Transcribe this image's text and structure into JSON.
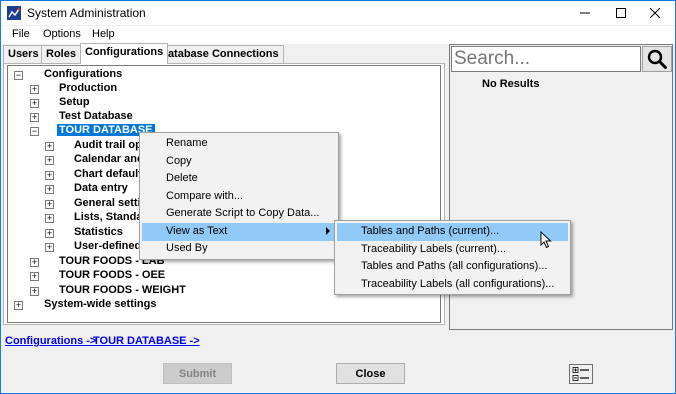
{
  "window": {
    "title": "System Administration"
  },
  "menubar": {
    "items": [
      "File",
      "Options",
      "Help"
    ]
  },
  "tabs": [
    "Users",
    "Roles",
    "Configurations",
    "Database Connections"
  ],
  "active_tab": "Configurations",
  "tree": {
    "rows": [
      {
        "label": "Configurations",
        "expander": "−"
      },
      {
        "label": "Production",
        "expander": "+"
      },
      {
        "label": "Setup",
        "expander": "+"
      },
      {
        "label": "Test Database",
        "expander": "+"
      },
      {
        "label": "TOUR DATABASE",
        "expander": "−",
        "selected": true
      },
      {
        "label": "Audit trail optio",
        "expander": "+"
      },
      {
        "label": "Calendar and c",
        "expander": "+"
      },
      {
        "label": "Chart defaults",
        "expander": "+"
      },
      {
        "label": "Data entry",
        "expander": "+"
      },
      {
        "label": "General setting",
        "expander": "+"
      },
      {
        "label": "Lists, Standard",
        "expander": "+"
      },
      {
        "label": "Statistics",
        "expander": "+"
      },
      {
        "label": "User-defined la",
        "expander": "+"
      },
      {
        "label": "TOUR FOODS - LAB",
        "expander": "+"
      },
      {
        "label": "TOUR FOODS - OEE",
        "expander": "+"
      },
      {
        "label": "TOUR FOODS - WEIGHT",
        "expander": "+"
      },
      {
        "label": "System-wide settings",
        "expander": "+"
      }
    ]
  },
  "search": {
    "placeholder": "Search...",
    "results_text": "No Results"
  },
  "breadcrumb": [
    "Configurations ->",
    "TOUR DATABASE ->"
  ],
  "buttons": {
    "submit": "Submit",
    "close": "Close"
  },
  "context_menu": {
    "items": [
      "Rename",
      "Copy",
      "Delete",
      "Compare with...",
      "Generate Script to Copy Data...",
      "View as Text",
      "Used By"
    ],
    "highlighted": "View as Text"
  },
  "submenu": {
    "items": [
      "Tables and Paths (current)...",
      "Traceability Labels (current)...",
      "Tables and Paths (all configurations)...",
      "Traceability Labels (all configurations)..."
    ],
    "highlighted": "Tables and Paths (current)..."
  },
  "colors": {
    "selection": "#0078d7",
    "menu_highlight": "#91c9f7",
    "link": "#0000ee"
  }
}
